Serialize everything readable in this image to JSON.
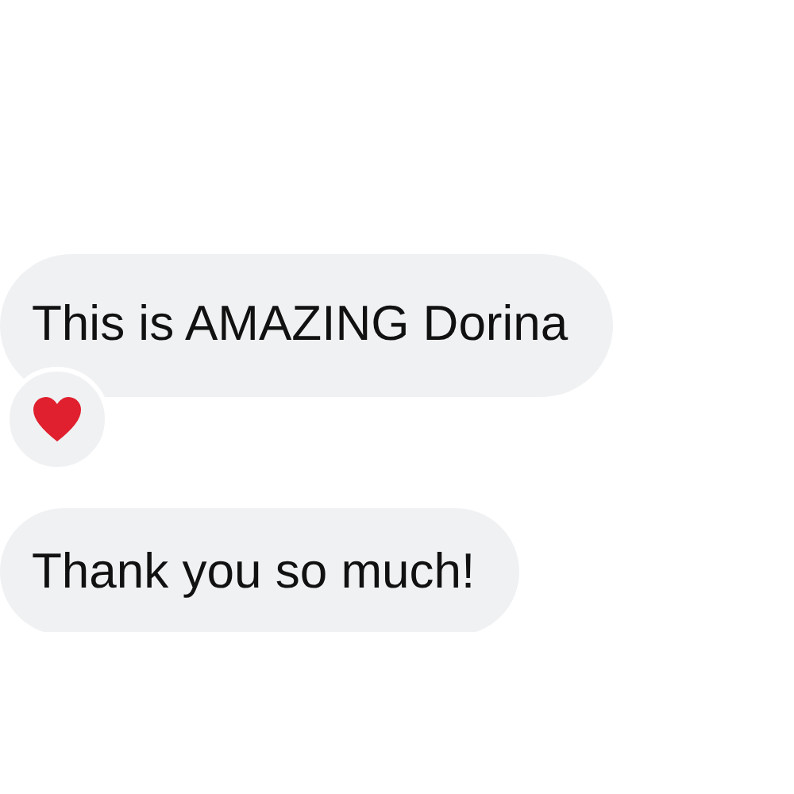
{
  "messages": [
    {
      "text": "This is AMAZING Dorina",
      "reaction": {
        "kind": "heart"
      }
    },
    {
      "text": "Thank you so much!"
    }
  ]
}
